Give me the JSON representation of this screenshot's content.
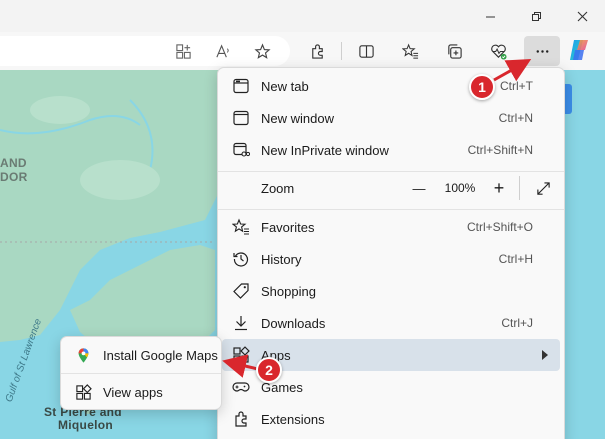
{
  "window": {
    "buttons": [
      "minimize",
      "restore",
      "close"
    ]
  },
  "toolbar": {
    "icons": [
      "app-available-icon",
      "read-aloud-icon",
      "favorite-star-icon",
      "extensions-icon",
      "split-screen-icon",
      "favorites-icon",
      "collections-icon",
      "browser-essentials-icon",
      "settings-more-icon",
      "copilot-icon"
    ]
  },
  "map": {
    "labels": {
      "land_1": "AND",
      "land_2": "DOR",
      "gulf": "Gulf of St Lawrence",
      "island_1": "St Pierre and",
      "island_2": "Miquelon"
    }
  },
  "menu": {
    "new_tab": {
      "label": "New tab",
      "shortcut": "Ctrl+T"
    },
    "new_window": {
      "label": "New window",
      "shortcut": "Ctrl+N"
    },
    "new_inprivate": {
      "label": "New InPrivate window",
      "shortcut": "Ctrl+Shift+N"
    },
    "zoom": {
      "label": "Zoom",
      "minus": "—",
      "value": "100%",
      "plus": "+"
    },
    "favorites": {
      "label": "Favorites",
      "shortcut": "Ctrl+Shift+O"
    },
    "history": {
      "label": "History",
      "shortcut": "Ctrl+H"
    },
    "shopping": {
      "label": "Shopping"
    },
    "downloads": {
      "label": "Downloads",
      "shortcut": "Ctrl+J"
    },
    "apps": {
      "label": "Apps"
    },
    "games": {
      "label": "Games"
    },
    "extensions": {
      "label": "Extensions"
    }
  },
  "submenu": {
    "install": {
      "label": "Install Google Maps"
    },
    "view_apps": {
      "label": "View apps"
    }
  },
  "callouts": {
    "one": "1",
    "two": "2"
  },
  "colors": {
    "callout": "#d9272d",
    "highlight": "#d8e1ea",
    "water": "#89d6e5",
    "land": "#a9d8c2"
  }
}
